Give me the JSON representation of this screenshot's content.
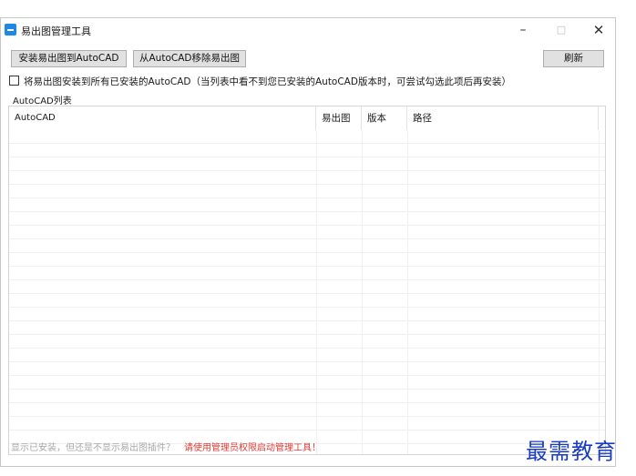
{
  "window": {
    "title": "易出图管理工具",
    "controls": {
      "minimize": "–",
      "maximize": "□",
      "close": "✕"
    }
  },
  "toolbar": {
    "install_label": "安装易出图到AutoCAD",
    "remove_label": "从AutoCAD移除易出图",
    "refresh_label": "刷新"
  },
  "option": {
    "checked": false,
    "label": "将易出图安装到所有已安装的AutoCAD（当列表中看不到您已安装的AutoCAD版本时，可尝试勾选此项后再安装）"
  },
  "list": {
    "group_label": "AutoCAD列表",
    "columns": [
      "AutoCAD",
      "易出图",
      "版本",
      "路径"
    ]
  },
  "footer": {
    "hint": "显示已安装，但还是不显示易出图插件？",
    "warning": "请使用管理员权限启动管理工具！"
  },
  "watermark": "最需教育",
  "colors": {
    "accent": "#1e88e5",
    "warning": "#e53935",
    "watermark": "#1a3dbf"
  },
  "icons": {
    "app": "app-icon",
    "checkbox": "checkbox-unchecked"
  }
}
